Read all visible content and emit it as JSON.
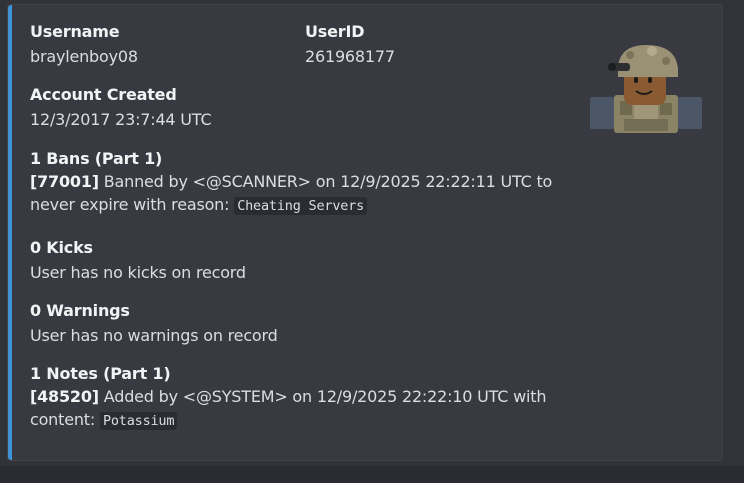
{
  "embed": {
    "accent_color": "#3c93d6",
    "fields": {
      "username": {
        "name": "Username",
        "value": "braylenboy08"
      },
      "userid": {
        "name": "UserID",
        "value": "261968177"
      },
      "created": {
        "name": "Account Created",
        "value": "12/3/2017 23:7:44 UTC"
      },
      "bans": {
        "name": "1 Bans (Part 1)",
        "id": "[77001]",
        "line1": " Banned by <@SCANNER> on 12/9/2025 22:22:11 UTC to",
        "line2": "never expire with reason: ",
        "reason": "Cheating Servers"
      },
      "kicks": {
        "name": "0 Kicks",
        "value": "User has no kicks on record"
      },
      "warnings": {
        "name": "0 Warnings",
        "value": "User has no warnings on record"
      },
      "notes": {
        "name": "1 Notes (Part 1)",
        "id": "[48520]",
        "line1": " Added by <@SYSTEM> on 12/9/2025 22:22:10 UTC with",
        "line2": "content: ",
        "content": "Potassium"
      }
    },
    "thumbnail_icon": "roblox-avatar-thumbnail"
  }
}
